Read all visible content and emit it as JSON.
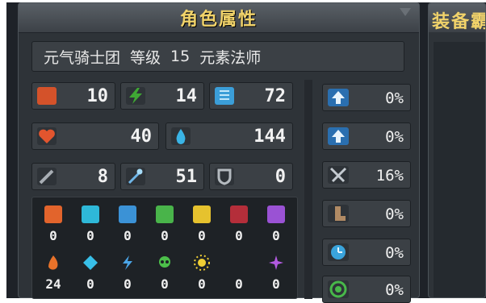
{
  "panel": {
    "title": "角色属性"
  },
  "info": {
    "guild": "元气骑士团",
    "level_label": "等级",
    "level": "15",
    "class": "元素法师"
  },
  "stats": [
    {
      "icon": "fist-icon",
      "value": "10",
      "color": "#d4522a"
    },
    {
      "icon": "lightning-icon",
      "value": "14",
      "color": "#3fa834"
    },
    {
      "icon": "book-icon",
      "value": "72",
      "color": "#3b9ed8"
    },
    {
      "icon": "heart-icon",
      "value": "40",
      "color": "#e2552e"
    },
    {
      "icon": "water-drop-icon",
      "value": "144",
      "color": "#3ab4e6"
    },
    {
      "icon": "sword-icon",
      "value": "8",
      "color": "#9aa0a6"
    },
    {
      "icon": "staff-icon",
      "value": "51",
      "color": "#6fb6e8"
    },
    {
      "icon": "shield-icon",
      "value": "0",
      "color": "#8e949a"
    }
  ],
  "elements": {
    "row1": [
      {
        "icon": "fire-shield-icon",
        "value": "0",
        "color": "#e2642c"
      },
      {
        "icon": "ice-shield-icon",
        "value": "0",
        "color": "#2eb8d8"
      },
      {
        "icon": "wind-shield-icon",
        "value": "0",
        "color": "#3b92d6"
      },
      {
        "icon": "poison-shield-icon",
        "value": "0",
        "color": "#49b44a"
      },
      {
        "icon": "light-shield-icon",
        "value": "0",
        "color": "#e6c22e"
      },
      {
        "icon": "dark-shield-icon",
        "value": "0",
        "color": "#b42e3a"
      },
      {
        "icon": "arcane-shield-icon",
        "value": "0",
        "color": "#9a52d4"
      }
    ],
    "row2": [
      {
        "icon": "fire-icon",
        "value": "24",
        "color": "#e8722a"
      },
      {
        "icon": "ice-crystal-icon",
        "value": "0",
        "color": "#38bfe8"
      },
      {
        "icon": "lightning-bolt-icon",
        "value": "0",
        "color": "#4aa4e6"
      },
      {
        "icon": "skull-icon",
        "value": "0",
        "color": "#4cbf4a"
      },
      {
        "icon": "sun-icon",
        "value": "0",
        "color": "#f0cf34"
      },
      {
        "icon": "moon-icon",
        "value": "0",
        "color": "#c0303e"
      },
      {
        "icon": "star-icon",
        "value": "0",
        "color": "#b25ae0"
      }
    ]
  },
  "right_stats": [
    {
      "icon": "arrow-up-icon",
      "value": "0%"
    },
    {
      "icon": "arrow-up-icon",
      "value": "0%"
    },
    {
      "icon": "crossed-swords-icon",
      "value": "16%"
    },
    {
      "icon": "boot-icon",
      "value": "0%"
    },
    {
      "icon": "clock-icon",
      "value": "0%"
    },
    {
      "icon": "target-icon",
      "value": "0%"
    }
  ],
  "equipment_panel": {
    "title": "装备霸"
  }
}
